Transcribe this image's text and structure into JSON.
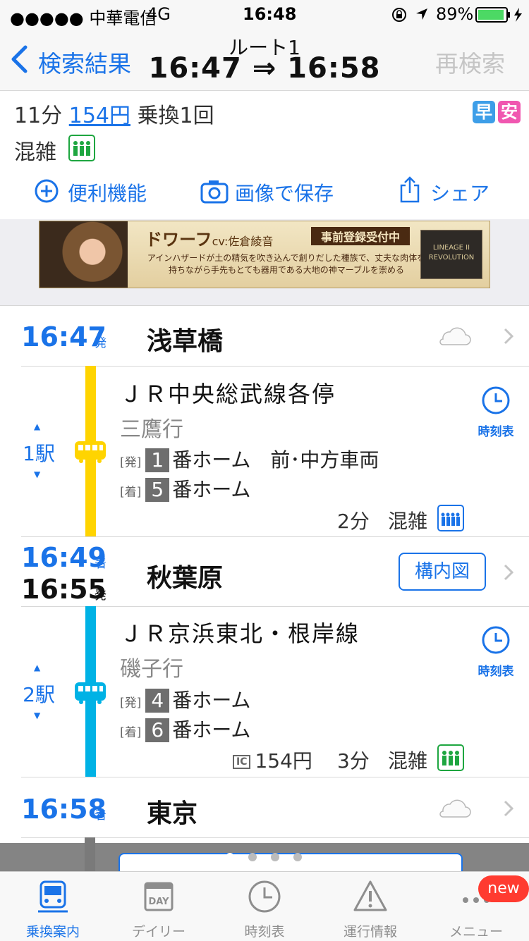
{
  "status": {
    "carrier": "●●●●● 中華電信",
    "network": "4G",
    "time": "16:48",
    "battery": "89%"
  },
  "nav": {
    "back": "検索結果",
    "route": "ルート1",
    "times": "16:47 ⇒ 16:58",
    "research": "再検索"
  },
  "summary": {
    "duration": "11分",
    "fare": "154円",
    "transfer": "乗換1回",
    "crowd": "混雑",
    "badges": [
      "早",
      "安"
    ]
  },
  "tools": [
    {
      "label": "便利機能"
    },
    {
      "label": "画像で保存"
    },
    {
      "label": "シェア"
    }
  ],
  "ad": {
    "title": "ドワーフ",
    "cv": "cv:佐倉綾音",
    "tag": "事前登録受付中",
    "body": "アインハザードが土の精気を吹き込んで創りだした種族で、丈夫な肉体を持ちながら手先もとても器用である大地の神マーブルを崇める",
    "logo": "LINEAGE II REVOLUTION"
  },
  "route": {
    "start": {
      "time": "16:47",
      "suffix": "発",
      "station": "浅草橋"
    },
    "seg1": {
      "line": "ＪＲ中央総武線各停",
      "dest": "三鷹行",
      "stops": "1駅",
      "dep_tag": "[発]",
      "dep_platform": "1",
      "dep_text": "番ホーム　前･中方車両",
      "arr_tag": "[着]",
      "arr_platform": "5",
      "arr_text": "番ホーム",
      "duration": "2分",
      "crowd": "混雑",
      "timetable": "時刻表",
      "color": "#ffd400"
    },
    "transfer": {
      "arr_time": "16:49",
      "arr_suffix": "着",
      "dep_time": "16:55",
      "dep_suffix": "発",
      "station": "秋葉原",
      "map_button": "構内図"
    },
    "seg2": {
      "line": "ＪＲ京浜東北・根岸線",
      "dest": "磯子行",
      "stops": "2駅",
      "dep_tag": "[発]",
      "dep_platform": "4",
      "dep_text": "番ホーム",
      "arr_tag": "[着]",
      "arr_platform": "6",
      "arr_text": "番ホーム",
      "ic": "IC",
      "fare": "154円",
      "duration": "3分",
      "crowd": "混雑",
      "timetable": "時刻表",
      "color": "#00b2e5"
    },
    "end": {
      "time": "16:58",
      "suffix": "着",
      "station": "東京"
    }
  },
  "tabs": [
    {
      "label": "乗換案内",
      "active": true
    },
    {
      "label": "デイリー"
    },
    {
      "label": "時刻表"
    },
    {
      "label": "運行情報"
    },
    {
      "label": "メニュー"
    }
  ],
  "new_badge": "new",
  "icons": {
    "day": "DAY"
  }
}
